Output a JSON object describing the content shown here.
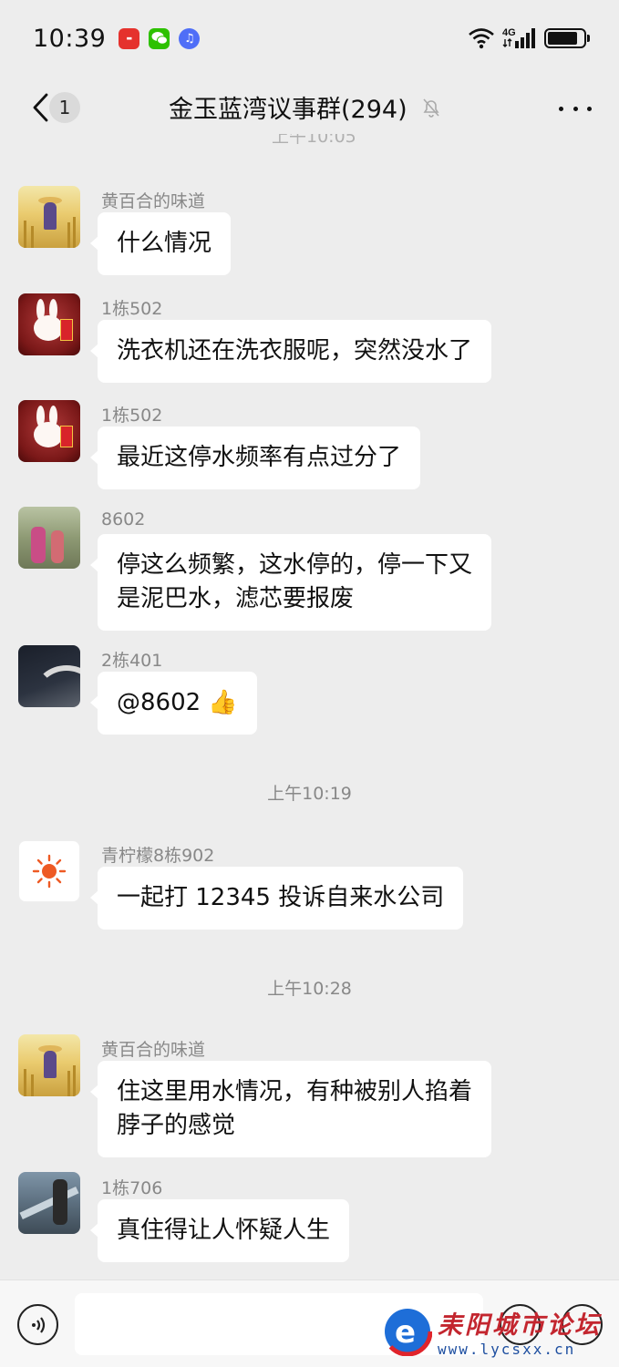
{
  "status_bar": {
    "time": "10:39",
    "notification_apps": [
      "huawei-app-icon",
      "wechat-icon",
      "music-icon"
    ],
    "network": "4G",
    "battery_level": 0.85
  },
  "header": {
    "back_unread_count": "1",
    "title": "金玉蓝湾议事群(294)",
    "muted_icon": "bell-off-icon",
    "more_icon": "more-dots-icon"
  },
  "messages": [
    {
      "sender": "黄百合的味道",
      "avatar": "field-avatar",
      "lines": [
        "什么情况"
      ]
    },
    {
      "sender": "1栋502",
      "avatar": "bunny-avatar",
      "lines": [
        "洗衣机还在洗衣服呢，突然没水了"
      ]
    },
    {
      "sender": "1栋502",
      "avatar": "bunny-avatar",
      "lines": [
        "最近这停水频率有点过分了"
      ]
    },
    {
      "sender": "8602",
      "avatar": "photo-avatar",
      "lines": [
        "停这么频繁，这水停的，停一下又",
        "是泥巴水，滤芯要报废"
      ]
    },
    {
      "sender": "2栋401",
      "avatar": "night-avatar",
      "lines": [
        "@8602 👍"
      ]
    },
    {
      "sender": "青柠檬8栋902",
      "avatar": "sun-avatar",
      "lines": [
        "一起打 12345 投诉自来水公司"
      ]
    },
    {
      "sender": "黄百合的味道",
      "avatar": "field-avatar",
      "lines": [
        "住这里用水情况，有种被别人掐着",
        "脖子的感觉"
      ]
    },
    {
      "sender": "1栋706",
      "avatar": "escalator-avatar",
      "lines": [
        "真住得让人怀疑人生"
      ]
    }
  ],
  "time_dividers": [
    "上午10:19",
    "上午10:28"
  ],
  "watermark": {
    "title": "耒阳城市论坛",
    "url": "www.lycsxx.cn"
  }
}
